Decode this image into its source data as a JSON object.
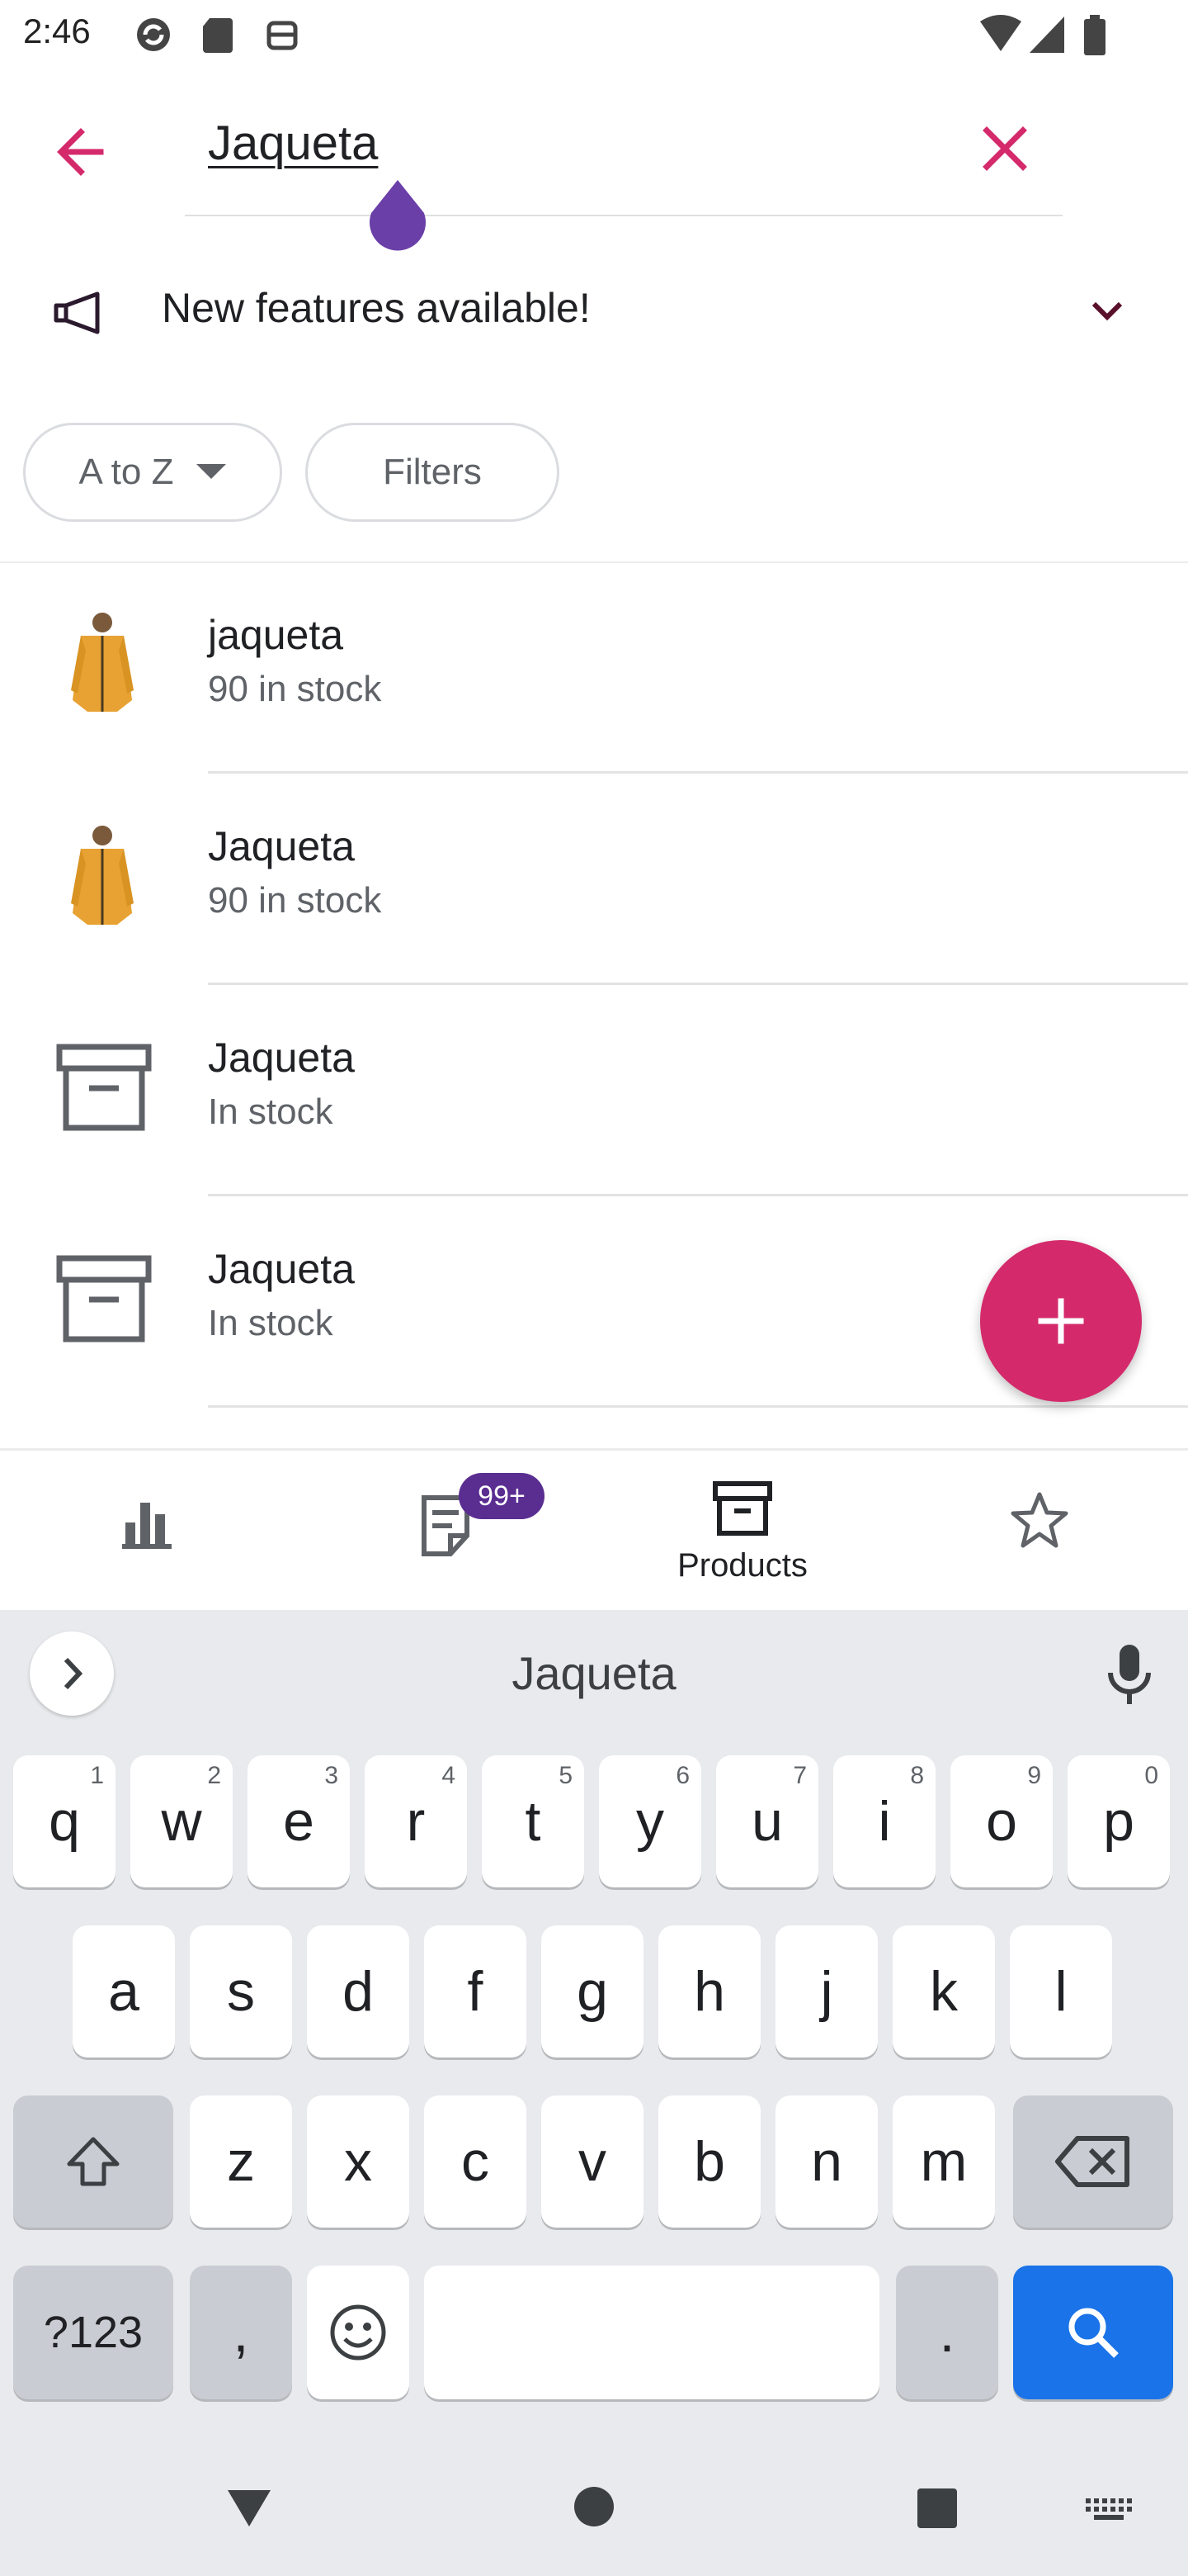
{
  "status_bar": {
    "time": "2:46"
  },
  "search": {
    "query": "Jaqueta"
  },
  "banner": {
    "text": "New features available!"
  },
  "chips": {
    "sort": "A to Z",
    "filters": "Filters"
  },
  "products": [
    {
      "name": "jaqueta",
      "stock": "90 in stock",
      "thumb": "jacket-image"
    },
    {
      "name": "Jaqueta",
      "stock": "90 in stock",
      "thumb": "jacket-image"
    },
    {
      "name": "Jaqueta",
      "stock": "In stock",
      "thumb": "archive-box-icon"
    },
    {
      "name": "Jaqueta",
      "stock": "In stock",
      "thumb": "archive-box-icon"
    }
  ],
  "bottom_nav": {
    "items": [
      {
        "icon": "bar-chart-icon",
        "label": ""
      },
      {
        "icon": "orders-icon",
        "label": ""
      },
      {
        "icon": "products-icon",
        "label": "Products"
      },
      {
        "icon": "star-icon",
        "label": ""
      }
    ],
    "orders_badge": "99+"
  },
  "keyboard": {
    "suggestion": "Jaqueta",
    "row1": [
      {
        "k": "q",
        "h": "1"
      },
      {
        "k": "w",
        "h": "2"
      },
      {
        "k": "e",
        "h": "3"
      },
      {
        "k": "r",
        "h": "4"
      },
      {
        "k": "t",
        "h": "5"
      },
      {
        "k": "y",
        "h": "6"
      },
      {
        "k": "u",
        "h": "7"
      },
      {
        "k": "i",
        "h": "8"
      },
      {
        "k": "o",
        "h": "9"
      },
      {
        "k": "p",
        "h": "0"
      }
    ],
    "row2": [
      "a",
      "s",
      "d",
      "f",
      "g",
      "h",
      "j",
      "k",
      "l"
    ],
    "row3": [
      "z",
      "x",
      "c",
      "v",
      "b",
      "n",
      "m"
    ],
    "symbols": "?123",
    "comma": ",",
    "period": "."
  },
  "colors": {
    "accent": "#d42a6b",
    "badge": "#5a2d91",
    "keyboard_action": "#1a73e8"
  }
}
